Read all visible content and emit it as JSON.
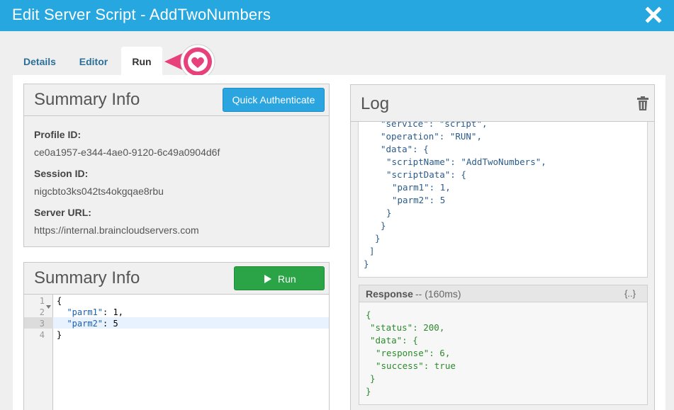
{
  "window": {
    "title": "Edit Server Script - AddTwoNumbers"
  },
  "tabs": [
    {
      "label": "Details"
    },
    {
      "label": "Editor"
    },
    {
      "label": "Run"
    }
  ],
  "summary": {
    "title": "Summary Info",
    "quick_auth_label": "Quick Authenticate",
    "profile_label": "Profile ID:",
    "profile_value": "ce0a1957-e344-4ae0-9120-6c49a0904d6f",
    "session_label": "Session ID:",
    "session_value": "nigcbto3ks042ts4okgqae8rbu",
    "server_label": "Server URL:",
    "server_value": "https://internal.braincloudservers.com"
  },
  "run_panel": {
    "title": "Summary Info",
    "run_label": "Run",
    "line_numbers": [
      "1",
      "2",
      "3",
      "4"
    ],
    "code": {
      "l1": "{",
      "l2_key": "\"parm1\"",
      "l2_rest": ": 1,",
      "l3_key": "\"parm2\"",
      "l3_rest": ": 5",
      "l4": "}"
    }
  },
  "log": {
    "title": "Log",
    "lines": [
      "\"service\": \"script\",",
      "\"operation\": \"RUN\",",
      "\"data\": {",
      "\"scriptName\": \"AddTwoNumbers\",",
      "\"scriptData\": {",
      "\"parm1\": 1,",
      "\"parm2\": 5",
      "}",
      "}",
      "}",
      "]",
      "}"
    ]
  },
  "response": {
    "label": "Response",
    "timing": "-- (160ms)",
    "toggle": "{..}",
    "lines": [
      "{",
      "\"status\": 200,",
      "\"data\": {",
      "\"response\": 6,",
      "\"success\": true",
      "}",
      "}"
    ]
  },
  "colors": {
    "title_bar": "#27a7df",
    "accent_blue": "#2ba5e0",
    "run_green": "#2aa447",
    "callout_pink": "#e8407a"
  },
  "icons": {
    "close": "close-icon",
    "trash": "trash-icon",
    "play": "play-icon",
    "heart": "heart-icon"
  }
}
